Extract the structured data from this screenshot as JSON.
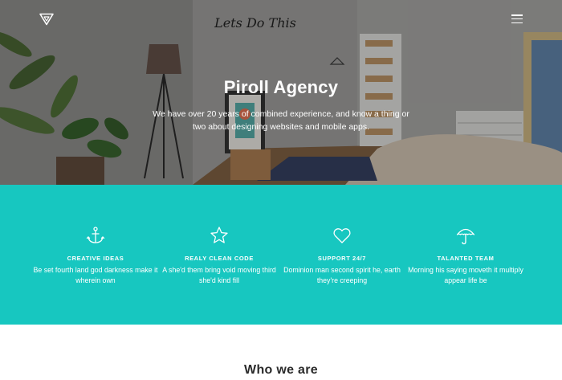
{
  "header": {
    "logo_icon": "triangle-logo-icon",
    "menu_icon": "hamburger-menu-icon"
  },
  "hero": {
    "wall_lettering": "Lets Do This",
    "title": "Piroll Agency",
    "text": "We have over 20 years of combined experience, and know a thing or two about designing websites and mobile apps."
  },
  "features": {
    "background_color": "#17c7c0",
    "items": [
      {
        "icon": "anchor-icon",
        "title": "CREATIVE IDEAS",
        "description": "Be set fourth land god darkness make it wherein own"
      },
      {
        "icon": "star-icon",
        "title": "REALY CLEAN CODE",
        "description": "A she'd them bring void moving third she'd kind fill"
      },
      {
        "icon": "heart-icon",
        "title": "SUPPORT 24/7",
        "description": "Dominion man second spirit he, earth they're creeping"
      },
      {
        "icon": "umbrella-icon",
        "title": "TALANTED TEAM",
        "description": "Morning his saying moveth it multiply appear life be"
      }
    ]
  },
  "about": {
    "title": "Who we are"
  }
}
